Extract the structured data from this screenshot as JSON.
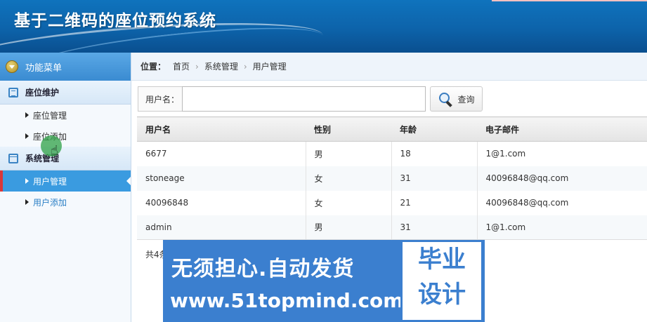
{
  "header": {
    "title": "基于二维码的座位预约系统"
  },
  "sidebar": {
    "menu_title": "功能菜单",
    "groups": [
      {
        "label": "座位维护",
        "items": [
          "座位管理",
          "座位添加"
        ]
      },
      {
        "label": "系统管理",
        "items": [
          "用户管理",
          "用户添加"
        ]
      }
    ],
    "active_item": "用户管理"
  },
  "breadcrumb": {
    "label": "位置：",
    "items": [
      "首页",
      "系统管理",
      "用户管理"
    ],
    "sep": "›"
  },
  "search": {
    "field_label": "用户名：",
    "value": "",
    "placeholder": "",
    "button_label": "查询"
  },
  "table": {
    "headers": [
      "用户名",
      "性别",
      "年龄",
      "电子邮件"
    ],
    "rows": [
      [
        "6677",
        "男",
        "18",
        "1@1.com"
      ],
      [
        "stoneage",
        "女",
        "31",
        "40096848@qq.com"
      ],
      [
        "40096848",
        "女",
        "21",
        "40096848@qq.com"
      ],
      [
        "admin",
        "男",
        "31",
        "1@1.com"
      ]
    ]
  },
  "footer": {
    "total_text": "共4条"
  },
  "watermark": {
    "line1": "无须担心.自动发货",
    "line2": "www.51topmind.com",
    "box_line1": "毕业",
    "box_line2": "设计"
  }
}
